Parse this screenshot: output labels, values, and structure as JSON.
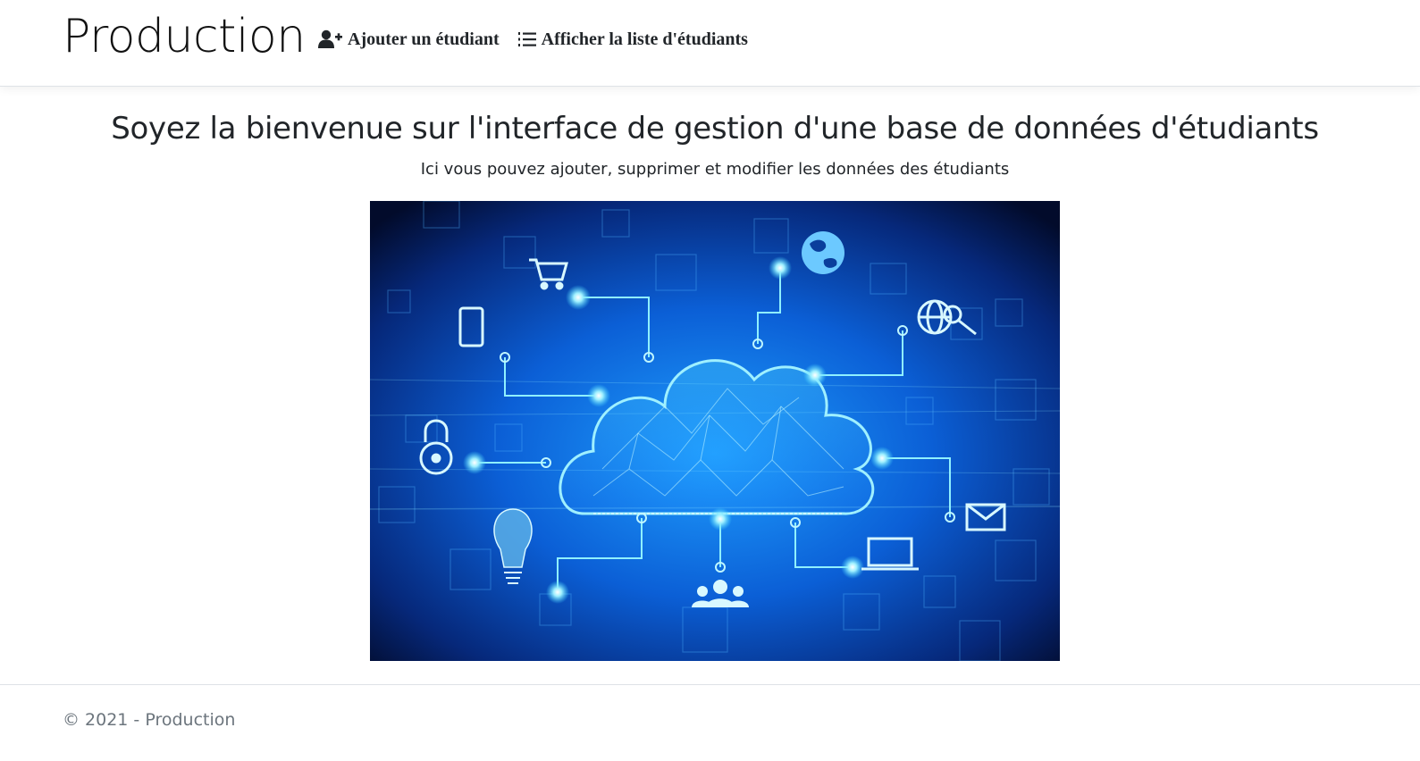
{
  "app": {
    "brand": "Production"
  },
  "nav": {
    "items": [
      {
        "label": "Ajouter un étudiant",
        "icon": "user-plus-icon"
      },
      {
        "label": "Afficher la liste d'étudiants",
        "icon": "list-ol-icon"
      }
    ]
  },
  "main": {
    "title": "Soyez la bienvenue sur l'interface de gestion d'une base de données d'étudiants",
    "subtitle": "Ici vous pouvez ajouter, supprimer et modifier les données des étudiants",
    "hero_image": "cloud-network-illustration"
  },
  "footer": {
    "text": "© 2021 - Production"
  },
  "colors": {
    "text": "#212529",
    "muted": "#6c757d",
    "border": "#dee2e6",
    "hero_glow": "#3fd6ff"
  }
}
